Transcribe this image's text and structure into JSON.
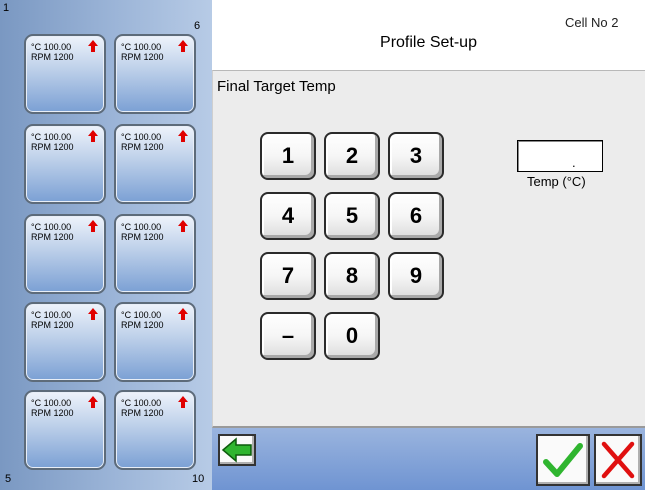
{
  "header": {
    "cell_no": "Cell No 2",
    "title": "Profile Set-up"
  },
  "left_panel": {
    "corner_top_left": "1",
    "corner_top_right": "6",
    "corner_bottom_left": "5",
    "corner_bottom_right": "10",
    "cells": [
      {
        "temp": "°C 100.00",
        "rpm": "RPM 1200"
      },
      {
        "temp": "°C 100.00",
        "rpm": "RPM 1200"
      },
      {
        "temp": "°C 100.00",
        "rpm": "RPM 1200"
      },
      {
        "temp": "°C 100.00",
        "rpm": "RPM 1200"
      },
      {
        "temp": "°C 100.00",
        "rpm": "RPM 1200"
      },
      {
        "temp": "°C 100.00",
        "rpm": "RPM 1200"
      },
      {
        "temp": "°C 100.00",
        "rpm": "RPM 1200"
      },
      {
        "temp": "°C 100.00",
        "rpm": "RPM 1200"
      },
      {
        "temp": "°C 100.00",
        "rpm": "RPM 1200"
      },
      {
        "temp": "°C 100.00",
        "rpm": "RPM 1200"
      }
    ],
    "arrow_icon": "red-up-arrow-icon",
    "arrow_color": "#e00000"
  },
  "content": {
    "label": "Final Target Temp",
    "keypad": [
      "1",
      "2",
      "3",
      "4",
      "5",
      "6",
      "7",
      "8",
      "9",
      "–",
      "0"
    ],
    "temp_display": ".",
    "temp_label": "Temp (°C)"
  },
  "bottom_bar": {
    "back_icon": "green-left-arrow-icon",
    "confirm_icon": "green-check-icon",
    "cancel_icon": "red-x-icon",
    "accent_green": "#2fb52f",
    "accent_red": "#e01010"
  }
}
